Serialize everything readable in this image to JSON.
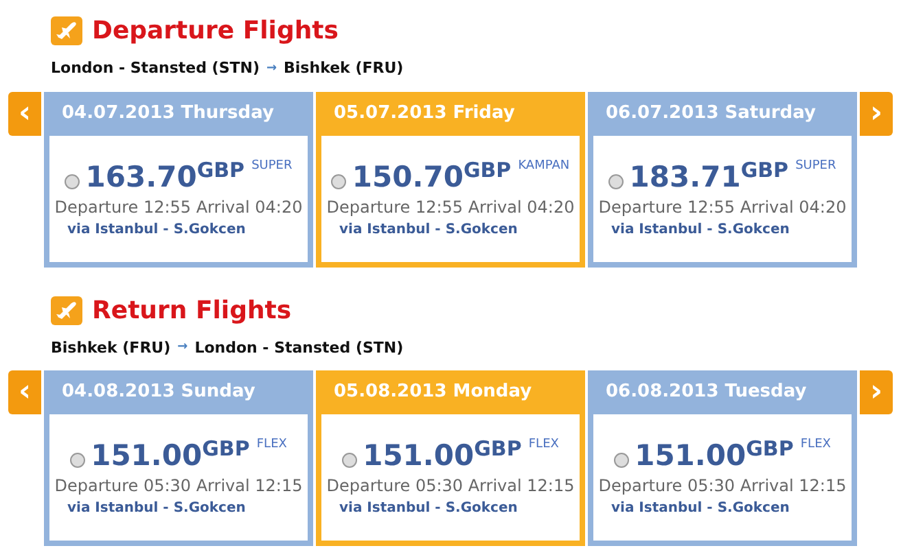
{
  "sections": [
    {
      "title": "Departure Flights",
      "route_from": "London - Stansted (STN)",
      "route_arrow": "→",
      "route_to": "Bishkek (FRU)",
      "prev": "‹",
      "next": "›",
      "days": [
        {
          "date": "04.07.2013 Thursday",
          "selected": false,
          "price": "163.70",
          "currency": "GBP",
          "fare": "SUPER",
          "times": "Departure 12:55 Arrival 04:20",
          "via": "via Istanbul - S.Gokcen",
          "checked": false
        },
        {
          "date": "05.07.2013 Friday",
          "selected": true,
          "price": "150.70",
          "currency": "GBP",
          "fare": "KAMPAN",
          "times": "Departure 12:55 Arrival 04:20",
          "via": "via Istanbul - S.Gokcen",
          "checked": false
        },
        {
          "date": "06.07.2013 Saturday",
          "selected": false,
          "price": "183.71",
          "currency": "GBP",
          "fare": "SUPER",
          "times": "Departure 12:55 Arrival 04:20",
          "via": "via Istanbul - S.Gokcen",
          "checked": false
        }
      ]
    },
    {
      "title": "Return Flights",
      "route_from": "Bishkek (FRU)",
      "route_arrow": "→",
      "route_to": "London - Stansted (STN)",
      "prev": "‹",
      "next": "›",
      "days": [
        {
          "date": "04.08.2013 Sunday",
          "selected": false,
          "price": "151.00",
          "currency": "GBP",
          "fare": "FLEX",
          "times": "Departure 05:30 Arrival 12:15",
          "via": "via Istanbul - S.Gokcen",
          "checked": false
        },
        {
          "date": "05.08.2013 Monday",
          "selected": true,
          "price": "151.00",
          "currency": "GBP",
          "fare": "FLEX",
          "times": "Departure 05:30 Arrival 12:15",
          "via": "via Istanbul - S.Gokcen",
          "checked": false
        },
        {
          "date": "06.08.2013 Tuesday",
          "selected": false,
          "price": "151.00",
          "currency": "GBP",
          "fare": "FLEX",
          "times": "Departure 05:30 Arrival 12:15",
          "via": "via Istanbul - S.Gokcen",
          "checked": false
        }
      ]
    }
  ]
}
